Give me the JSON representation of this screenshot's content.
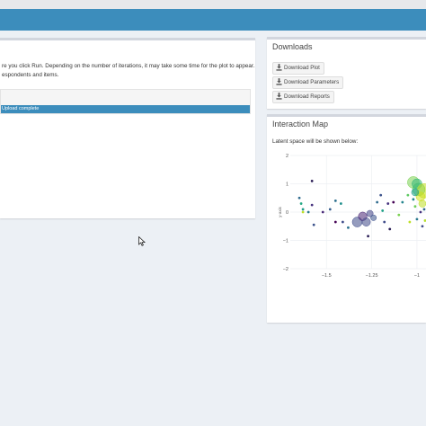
{
  "header": {
    "color": "#3c8dbc"
  },
  "main_panel": {
    "intro_lines": [
      "re you click Run. Depending on the number of iterations, it may take some time for the plot to appear.",
      "espondents and items."
    ],
    "progress": {
      "status_text": "Upload complete",
      "percent": 100,
      "bar_color": "#3c8dbc"
    }
  },
  "downloads": {
    "title": "Downloads",
    "buttons": [
      {
        "label": "Download Plot",
        "icon": "download-icon"
      },
      {
        "label": "Download Parameters",
        "icon": "download-icon"
      },
      {
        "label": "Download Reports",
        "icon": "download-icon"
      }
    ]
  },
  "interaction_map": {
    "title": "Interaction Map",
    "caption": "Latent space will be shown below:"
  },
  "chart_data": {
    "type": "scatter",
    "ylabel": "y-axis",
    "xlim": [
      -1.7,
      -0.95
    ],
    "ylim": [
      -2,
      2
    ],
    "x_ticks": [
      -1.5,
      -1.25,
      -1
    ],
    "x_tick_labels": [
      "−1.5",
      "−1.25",
      "−1"
    ],
    "y_ticks": [
      2,
      1,
      0,
      -1,
      -2
    ],
    "y_tick_labels": [
      "2",
      "1",
      "0",
      "−1",
      "−2"
    ],
    "grid": true,
    "points": [
      {
        "x": -1.58,
        "y": 1.1,
        "r": 1.4,
        "color": "#2a1d55"
      },
      {
        "x": -1.65,
        "y": 0.5,
        "r": 1.4,
        "color": "#2f6b8e"
      },
      {
        "x": -1.64,
        "y": 0.3,
        "r": 1.4,
        "color": "#22a884"
      },
      {
        "x": -1.63,
        "y": 0.1,
        "r": 1.4,
        "color": "#1e9c89"
      },
      {
        "x": -1.63,
        "y": 0.0,
        "r": 1.4,
        "color": "#bddf26"
      },
      {
        "x": -1.6,
        "y": 0.0,
        "r": 1.4,
        "color": "#2a788e"
      },
      {
        "x": -1.58,
        "y": 0.25,
        "r": 1.4,
        "color": "#46327e"
      },
      {
        "x": -1.57,
        "y": -0.45,
        "r": 1.4,
        "color": "#3b528b"
      },
      {
        "x": -1.52,
        "y": 0.0,
        "r": 1.4,
        "color": "#482878"
      },
      {
        "x": -1.48,
        "y": 0.1,
        "r": 1.4,
        "color": "#365c8d"
      },
      {
        "x": -1.45,
        "y": 0.4,
        "r": 1.4,
        "color": "#2d708e"
      },
      {
        "x": -1.45,
        "y": -0.35,
        "r": 1.4,
        "color": "#440154"
      },
      {
        "x": -1.42,
        "y": 0.3,
        "r": 1.4,
        "color": "#21908d"
      },
      {
        "x": -1.41,
        "y": -0.35,
        "r": 1.4,
        "color": "#3e4a89"
      },
      {
        "x": -1.38,
        "y": -0.55,
        "r": 1.4,
        "color": "#2c728e"
      },
      {
        "x": -1.33,
        "y": -0.35,
        "r": 5.5,
        "color": "#3e4a89"
      },
      {
        "x": -1.3,
        "y": -0.15,
        "r": 4.8,
        "color": "#482475"
      },
      {
        "x": -1.28,
        "y": -0.35,
        "r": 4.6,
        "color": "#3f4889"
      },
      {
        "x": -1.26,
        "y": -0.05,
        "r": 3.6,
        "color": "#414487"
      },
      {
        "x": -1.24,
        "y": -0.2,
        "r": 3.2,
        "color": "#3b528b"
      },
      {
        "x": -1.27,
        "y": -0.85,
        "r": 1.4,
        "color": "#2a1d55"
      },
      {
        "x": -1.22,
        "y": 0.35,
        "r": 1.4,
        "color": "#2f6b8e"
      },
      {
        "x": -1.2,
        "y": 0.6,
        "r": 1.4,
        "color": "#3b528b"
      },
      {
        "x": -1.19,
        "y": 0.05,
        "r": 1.4,
        "color": "#1fa187"
      },
      {
        "x": -1.18,
        "y": -0.35,
        "r": 1.4,
        "color": "#3e4a89"
      },
      {
        "x": -1.16,
        "y": 0.3,
        "r": 1.4,
        "color": "#46327e"
      },
      {
        "x": -1.15,
        "y": -0.6,
        "r": 1.4,
        "color": "#2a1d55"
      },
      {
        "x": -1.13,
        "y": 0.35,
        "r": 1.4,
        "color": "#440154"
      },
      {
        "x": -1.1,
        "y": -0.1,
        "r": 1.4,
        "color": "#7ad151"
      },
      {
        "x": -1.08,
        "y": 0.35,
        "r": 1.4,
        "color": "#25858e"
      },
      {
        "x": -1.05,
        "y": 0.6,
        "r": 1.4,
        "color": "#5ec962"
      },
      {
        "x": -1.04,
        "y": -0.35,
        "r": 1.4,
        "color": "#bddf26"
      },
      {
        "x": -1.02,
        "y": 0.45,
        "r": 1.4,
        "color": "#24868e"
      },
      {
        "x": -1.01,
        "y": 0.2,
        "r": 1.4,
        "color": "#6ece58"
      },
      {
        "x": -1.0,
        "y": -0.25,
        "r": 1.4,
        "color": "#2a788e"
      },
      {
        "x": -0.98,
        "y": 0.0,
        "r": 1.4,
        "color": "#46327e"
      },
      {
        "x": -0.97,
        "y": -0.5,
        "r": 1.4,
        "color": "#3e4a89"
      },
      {
        "x": -0.96,
        "y": 0.1,
        "r": 1.4,
        "color": "#2f6b8e"
      },
      {
        "x": -0.955,
        "y": -0.3,
        "r": 1.4,
        "color": "#b5de2b"
      },
      {
        "x": -1.02,
        "y": 1.05,
        "r": 6.5,
        "color": "#7ad151"
      },
      {
        "x": -0.99,
        "y": 0.8,
        "r": 7.0,
        "color": "#52c569"
      },
      {
        "x": -1.0,
        "y": 1.0,
        "r": 5.5,
        "color": "#35b779"
      },
      {
        "x": -0.98,
        "y": 0.55,
        "r": 5.0,
        "color": "#d8e219"
      },
      {
        "x": -0.96,
        "y": 0.75,
        "r": 8.0,
        "color": "#c2df23"
      },
      {
        "x": -0.97,
        "y": 0.3,
        "r": 4.0,
        "color": "#bddf26"
      },
      {
        "x": -1.01,
        "y": 0.7,
        "r": 4.0,
        "color": "#1f9e89"
      }
    ]
  }
}
